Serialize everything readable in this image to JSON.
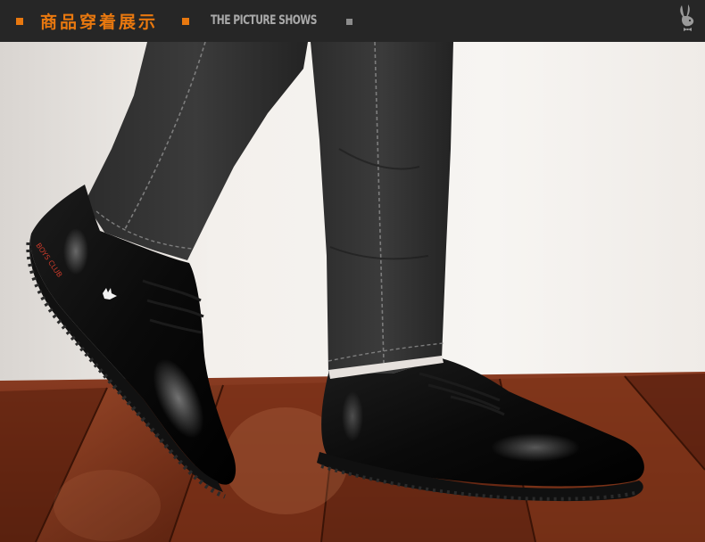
{
  "header": {
    "title_cn": "商品穿着展示",
    "title_en": "THE PICTURE SHOWS",
    "logo_icon": "bunny-logo-icon"
  },
  "colors": {
    "header_bg": "#262626",
    "accent": "#e8780f",
    "subtitle": "#a9a9a9",
    "square_right": "#8c8c8c"
  },
  "photo": {
    "shoe_print": "BOYS CLUB"
  }
}
